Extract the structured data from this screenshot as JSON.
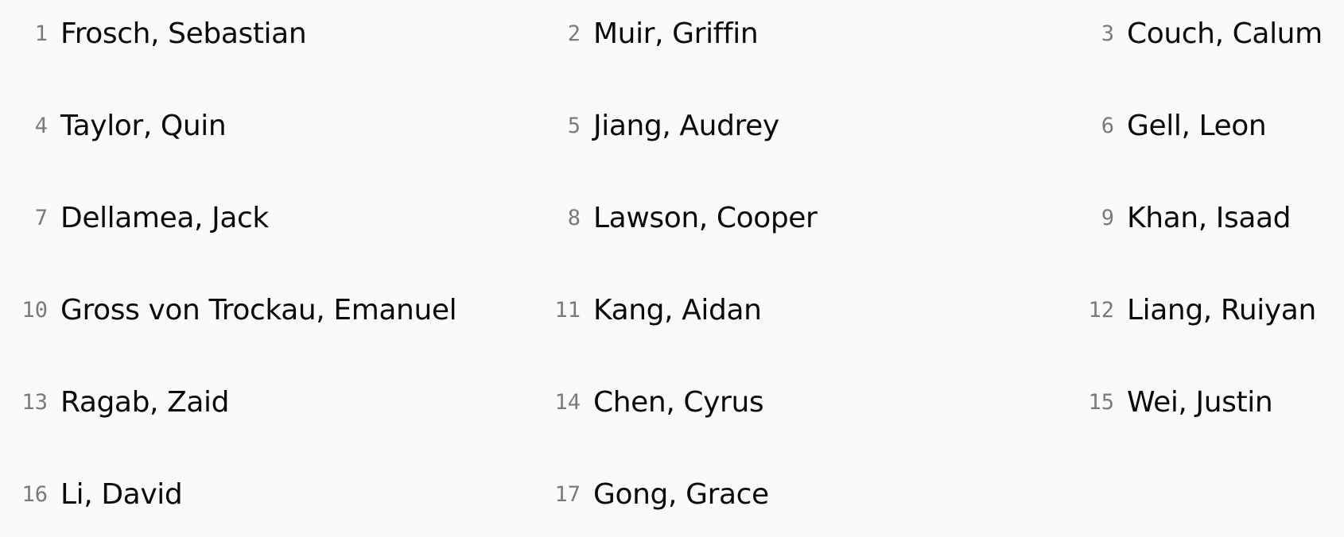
{
  "roster": {
    "entries": [
      {
        "number": "1",
        "name": "Frosch, Sebastian"
      },
      {
        "number": "2",
        "name": "Muir, Griffin"
      },
      {
        "number": "3",
        "name": "Couch, Calum"
      },
      {
        "number": "4",
        "name": "Taylor, Quin"
      },
      {
        "number": "5",
        "name": "Jiang, Audrey"
      },
      {
        "number": "6",
        "name": "Gell, Leon"
      },
      {
        "number": "7",
        "name": "Dellamea, Jack"
      },
      {
        "number": "8",
        "name": "Lawson, Cooper"
      },
      {
        "number": "9",
        "name": "Khan, Isaad"
      },
      {
        "number": "10",
        "name": "Gross von Trockau, Emanuel"
      },
      {
        "number": "11",
        "name": "Kang, Aidan"
      },
      {
        "number": "12",
        "name": "Liang, Ruiyan"
      },
      {
        "number": "13",
        "name": "Ragab, Zaid"
      },
      {
        "number": "14",
        "name": "Chen, Cyrus"
      },
      {
        "number": "15",
        "name": "Wei, Justin"
      },
      {
        "number": "16",
        "name": "Li, David"
      },
      {
        "number": "17",
        "name": "Gong, Grace"
      }
    ]
  }
}
